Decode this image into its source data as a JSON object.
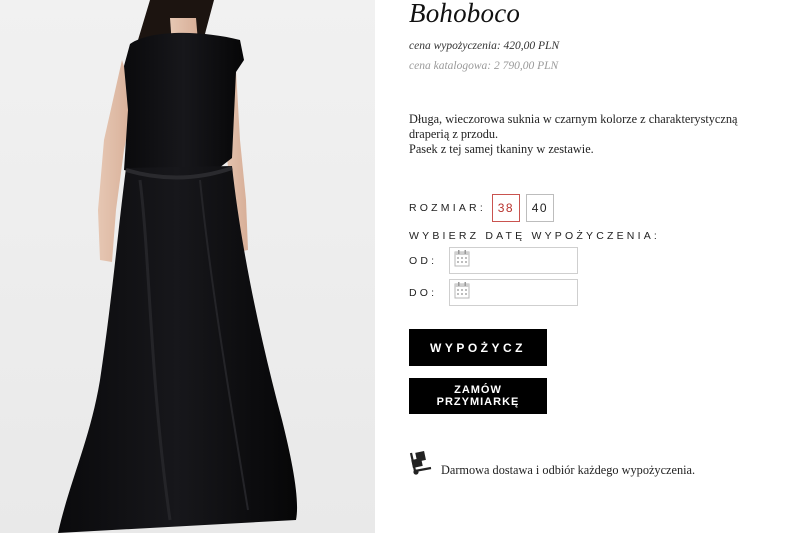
{
  "product": {
    "name": "Bohoboco",
    "rent_price": "cena wypożyczenia: 420,00 PLN",
    "catalog_price": "cena katalogowa: 2 790,00 PLN",
    "description_line1": "Długa, wieczorowa suknia w czarnym kolorze z charakterystyczną draperią z przodu.",
    "description_line2": "Pasek z tej samej tkaniny w zestawie."
  },
  "size": {
    "label": "ROZMIAR:",
    "options": [
      "38",
      "40"
    ],
    "selected": "38"
  },
  "dates": {
    "heading": "WYBIERZ DATĘ WYPOŻYCZENIA:",
    "from_label": "OD:",
    "to_label": "DO:",
    "from_value": "",
    "to_value": ""
  },
  "buttons": {
    "rent": "WYPOŻYCZ",
    "fitting": "ZAMÓW PRZYMIARKĘ"
  },
  "delivery": {
    "text": "Darmowa dostawa i odbiór każdego wypożyczenia.",
    "icon": "delivery-truck-icon"
  },
  "colors": {
    "button_bg": "#000000",
    "selected_size": "#b8312c"
  }
}
